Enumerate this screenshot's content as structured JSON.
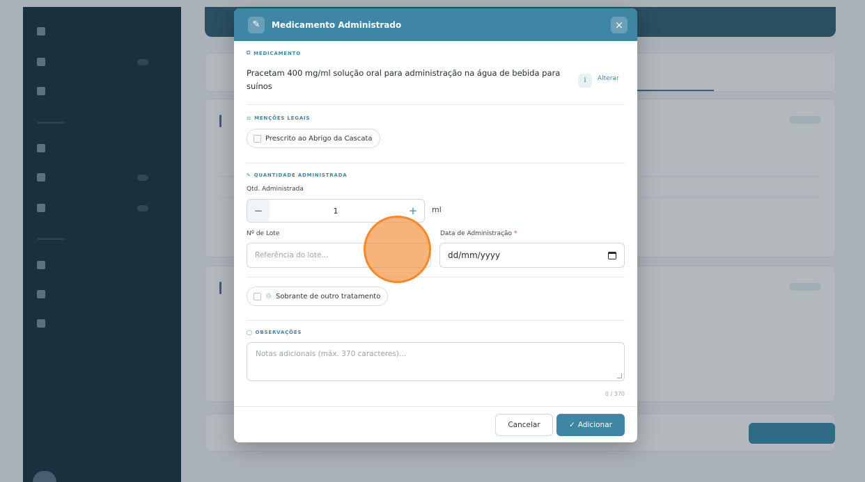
{
  "modal": {
    "title": "Medicamento Administrado",
    "close_glyph": "×",
    "header_icon_glyph": "✎",
    "sections": {
      "medication": {
        "label": "MEDICAMENTO",
        "icon_glyph": "⛋",
        "name": "Pracetam 400 mg/ml solução oral para administração na água de bebida para suínos",
        "info_glyph": "i",
        "change_label": "Alterar"
      },
      "legal": {
        "label": "MENÇÕES LEGAIS",
        "icon_glyph": "⚖",
        "checkbox_label": "Prescrito ao Abrigo da Cascata"
      },
      "quantity": {
        "label": "QUANTIDADE ADMINISTRADA",
        "icon_glyph": "✎",
        "qty_label": "Qtd. Administrada",
        "qty_value": "1",
        "minus_glyph": "−",
        "plus_glyph": "+",
        "unit": "ml",
        "lot_label": "Nº de Lote",
        "lot_placeholder": "Referência do lote...",
        "date_label": "Data de Administração",
        "date_required": "*",
        "date_placeholder": "dd/mm/yyyy",
        "leftover_icon_glyph": "♲",
        "leftover_label": "Sobrante de outro tratamento"
      },
      "notes": {
        "label": "OBSERVAÇÕES",
        "icon_glyph": "◯",
        "placeholder": "Notas adicionais (máx. 370 caracteres)...",
        "char_count": "0 / 370"
      }
    },
    "footer": {
      "cancel_label": "Cancelar",
      "add_glyph": "✓",
      "add_label": "Adicionar"
    }
  },
  "colors": {
    "accent": "#3f86a4",
    "sidebar": "#1f3a4a",
    "touch": "#f08a32"
  }
}
